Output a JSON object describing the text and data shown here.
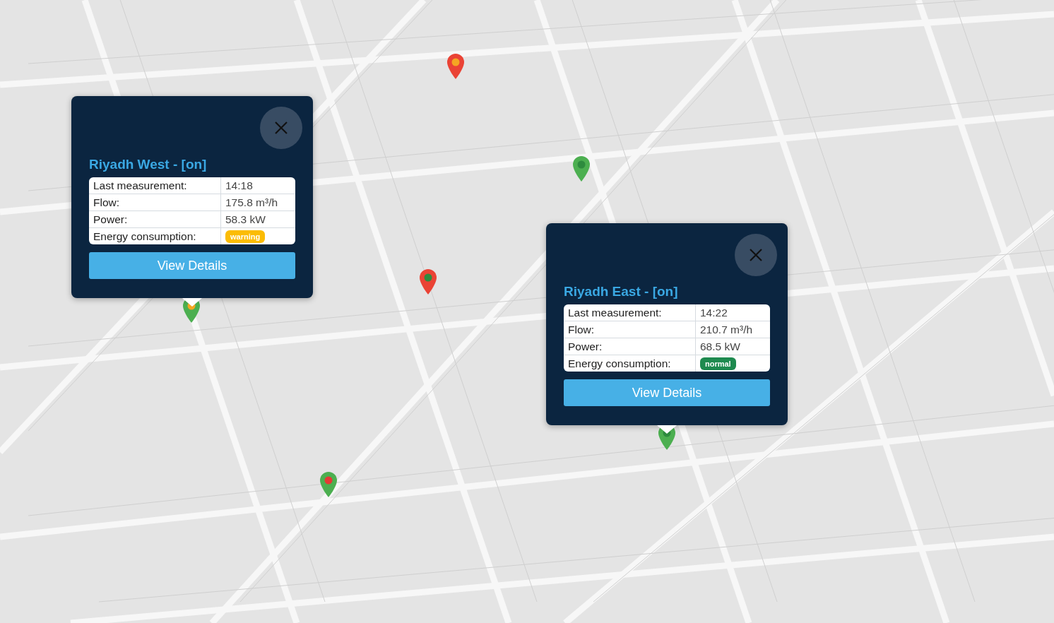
{
  "markers": [
    {
      "color": "#ea4335",
      "kind": "warning"
    },
    {
      "color": "#4caf50",
      "kind": "normal"
    },
    {
      "color": "#ea4335",
      "kind": "normal"
    },
    {
      "color": "#4caf50",
      "kind": "warning"
    },
    {
      "color": "#4caf50",
      "kind": "alarm"
    },
    {
      "color": "#4caf50",
      "kind": "normal"
    }
  ],
  "popups": [
    {
      "title": "Riyadh West - [on]",
      "rows": [
        {
          "label": "Last measurement:",
          "value": "14:18"
        },
        {
          "label": "Flow:",
          "value": "175.8 m³/h"
        },
        {
          "label": "Power:",
          "value": "58.3 kW"
        }
      ],
      "status_label": "Energy consumption:",
      "status": {
        "text": "warning",
        "kind": "warning"
      },
      "button": "View Details"
    },
    {
      "title": "Riyadh East - [on]",
      "rows": [
        {
          "label": "Last measurement:",
          "value": "14:22"
        },
        {
          "label": "Flow:",
          "value": "210.7 m³/h"
        },
        {
          "label": "Power:",
          "value": "68.5 kW"
        }
      ],
      "status_label": "Energy consumption:",
      "status": {
        "text": "normal",
        "kind": "normal"
      },
      "button": "View Details"
    }
  ]
}
